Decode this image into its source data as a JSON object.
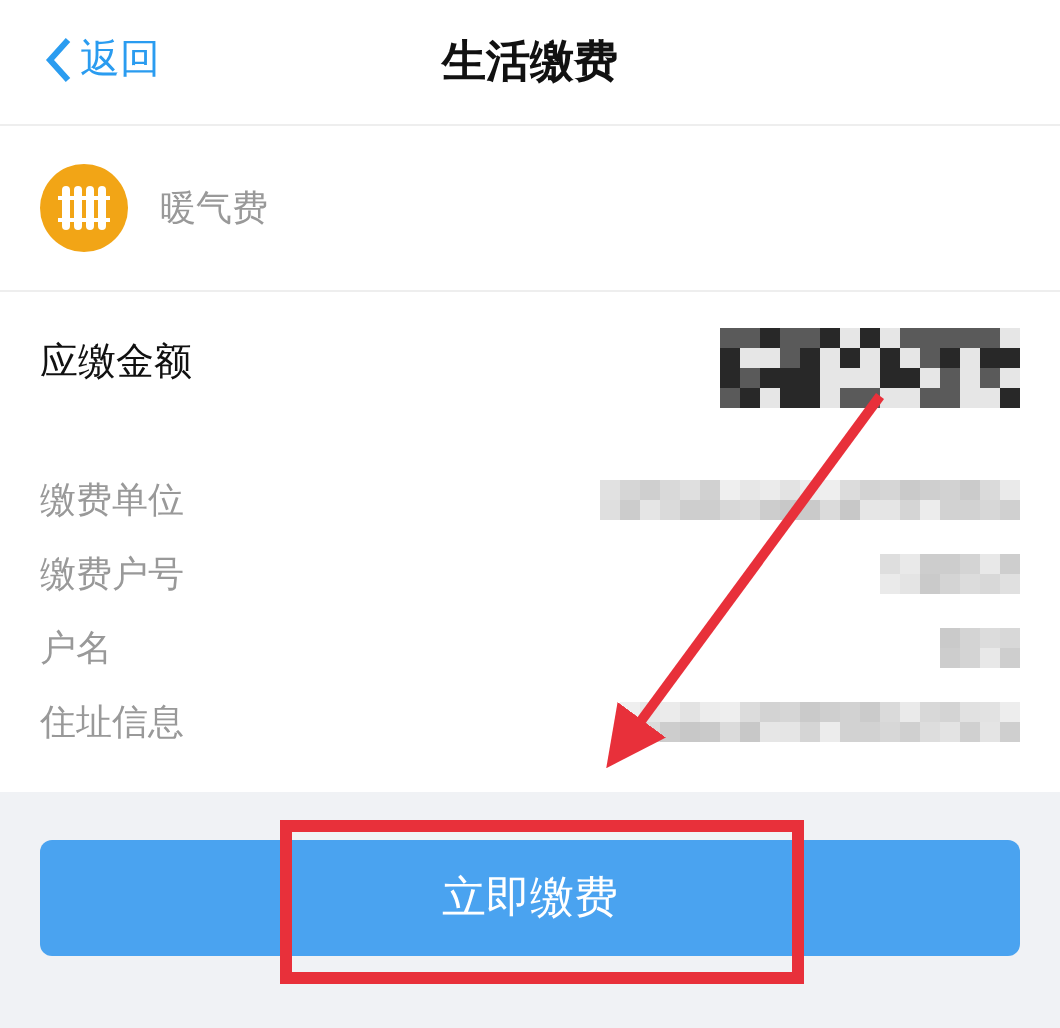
{
  "header": {
    "back_label": "返回",
    "title": "生活缴费"
  },
  "category": {
    "name": "暖气费"
  },
  "amount": {
    "label": "应缴金额"
  },
  "details": [
    {
      "label": "缴费单位"
    },
    {
      "label": "缴费户号"
    },
    {
      "label": "户名"
    },
    {
      "label": "住址信息"
    }
  ],
  "pay_button": {
    "label": "立即缴费"
  }
}
